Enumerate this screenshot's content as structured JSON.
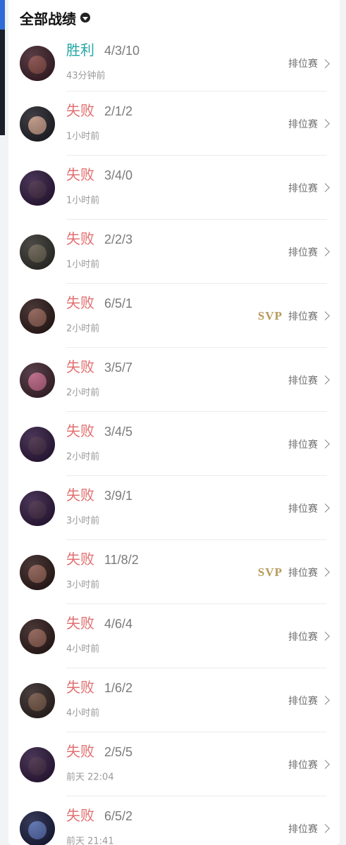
{
  "header": {
    "title": "全部战绩"
  },
  "colors": {
    "win": "#25a6a6",
    "lose": "#e26f6f",
    "svp": "#b89a5a"
  },
  "matches": [
    {
      "result": "胜利",
      "kda": "4/3/10",
      "time": "43分钟前",
      "mode": "排位赛",
      "svp": "",
      "avatar_bg": "#3b1a24",
      "avatar_face": "#7c3f3b"
    },
    {
      "result": "失败",
      "kda": "2/1/2",
      "time": "1小时前",
      "mode": "排位赛",
      "svp": "",
      "avatar_bg": "#1d1c24",
      "avatar_face": "#b78d7a"
    },
    {
      "result": "失败",
      "kda": "3/4/0",
      "time": "1小时前",
      "mode": "排位赛",
      "svp": "",
      "avatar_bg": "#2a133a",
      "avatar_face": "#3a203d"
    },
    {
      "result": "失败",
      "kda": "2/2/3",
      "time": "1小时前",
      "mode": "排位赛",
      "svp": "",
      "avatar_bg": "#2c2b26",
      "avatar_face": "#5d5645"
    },
    {
      "result": "失败",
      "kda": "6/5/1",
      "time": "2小时前",
      "mode": "排位赛",
      "svp": "SVP",
      "avatar_bg": "#2a1515",
      "avatar_face": "#845347"
    },
    {
      "result": "失败",
      "kda": "3/5/7",
      "time": "2小时前",
      "mode": "排位赛",
      "svp": "",
      "avatar_bg": "#3b1f2a",
      "avatar_face": "#b45a7a"
    },
    {
      "result": "失败",
      "kda": "3/4/5",
      "time": "2小时前",
      "mode": "排位赛",
      "svp": "",
      "avatar_bg": "#2a133a",
      "avatar_face": "#3a203d"
    },
    {
      "result": "失败",
      "kda": "3/9/1",
      "time": "3小时前",
      "mode": "排位赛",
      "svp": "",
      "avatar_bg": "#2a133a",
      "avatar_face": "#3a203d"
    },
    {
      "result": "失败",
      "kda": "11/8/2",
      "time": "3小时前",
      "mode": "排位赛",
      "svp": "SVP",
      "avatar_bg": "#2a1515",
      "avatar_face": "#845347"
    },
    {
      "result": "失败",
      "kda": "4/6/4",
      "time": "4小时前",
      "mode": "排位赛",
      "svp": "",
      "avatar_bg": "#2a1515",
      "avatar_face": "#845347"
    },
    {
      "result": "失败",
      "kda": "1/6/2",
      "time": "4小时前",
      "mode": "排位赛",
      "svp": "",
      "avatar_bg": "#2a1d1d",
      "avatar_face": "#6a4b3b"
    },
    {
      "result": "失败",
      "kda": "2/5/5",
      "time": "前天 22:04",
      "mode": "排位赛",
      "svp": "",
      "avatar_bg": "#2a133a",
      "avatar_face": "#3a203d"
    },
    {
      "result": "失败",
      "kda": "6/5/2",
      "time": "前天 21:41",
      "mode": "排位赛",
      "svp": "",
      "avatar_bg": "#14183a",
      "avatar_face": "#4b63a6"
    }
  ]
}
